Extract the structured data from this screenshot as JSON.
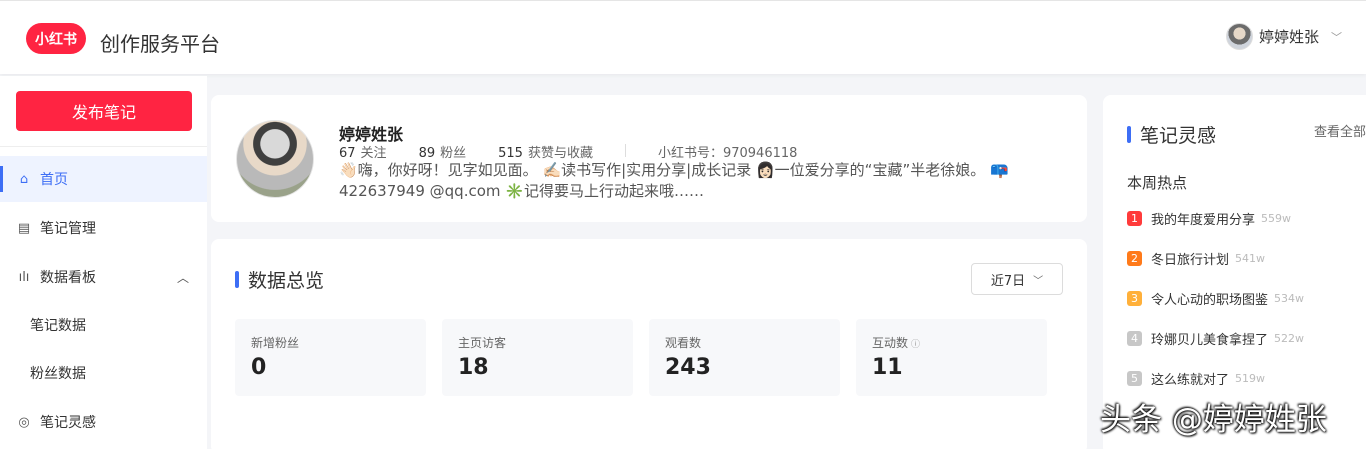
{
  "header": {
    "logo_text": "小红书",
    "app_title": "创作服务平台",
    "user_name": "婷婷姓张"
  },
  "sidebar": {
    "publish_label": "发布笔记",
    "items": [
      {
        "label": "首页",
        "icon": "home-icon"
      },
      {
        "label": "笔记管理",
        "icon": "note-icon"
      },
      {
        "label": "数据看板",
        "icon": "bar-chart-icon"
      },
      {
        "label": "笔记数据"
      },
      {
        "label": "粉丝数据"
      },
      {
        "label": "笔记灵感",
        "icon": "inspiration-icon"
      }
    ]
  },
  "profile": {
    "name": "婷婷姓张",
    "following_count": "67",
    "following_label": "关注",
    "fans_count": "89",
    "fans_label": "粉丝",
    "likes_count": "515",
    "likes_label": "获赞与收藏",
    "red_id": "小红书号：970946118",
    "bio": "👋🏻嗨，你好呀！见字如见面。 ✍🏻读书写作|实用分享|成长记录 👩🏻一位爱分享的“宝藏”半老徐娘。 📪422637949 @qq.com ✳️记得要马上行动起来哦……"
  },
  "overview": {
    "title": "数据总览",
    "range": "近7日",
    "stats": [
      {
        "label": "新增粉丝",
        "value": "0"
      },
      {
        "label": "主页访客",
        "value": "18"
      },
      {
        "label": "观看数",
        "value": "243"
      },
      {
        "label": "互动数",
        "value": "11"
      }
    ]
  },
  "inspiration": {
    "title": "笔记灵感",
    "see_all": "查看全部",
    "section": "本周热点",
    "items": [
      {
        "rank": "1",
        "title": "我的年度爱用分享",
        "count": "559w",
        "color": "#ff3b3b"
      },
      {
        "rank": "2",
        "title": "冬日旅行计划",
        "count": "541w",
        "color": "#ff7a1a"
      },
      {
        "rank": "3",
        "title": "令人心动的职场图鉴",
        "count": "534w",
        "color": "#ffb03a"
      },
      {
        "rank": "4",
        "title": "玲娜贝儿美食拿捏了",
        "count": "522w",
        "color": "#c7c7c7"
      },
      {
        "rank": "5",
        "title": "这么练就对了",
        "count": "519w",
        "color": "#c7c7c7"
      }
    ]
  },
  "watermark": "头条 @婷婷姓张"
}
